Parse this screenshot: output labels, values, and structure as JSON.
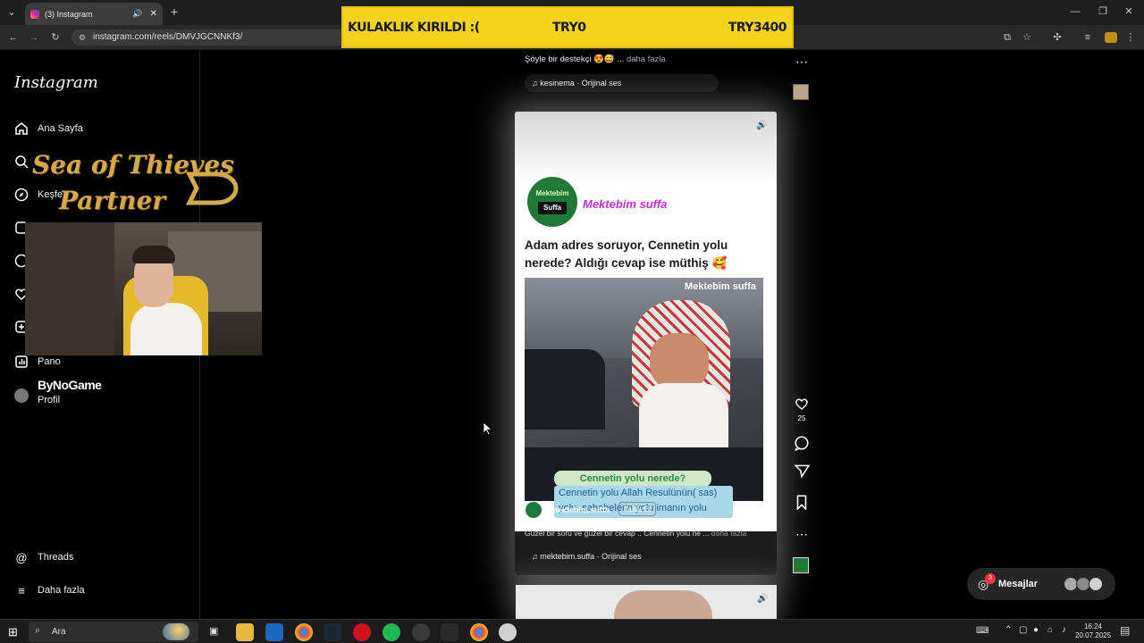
{
  "browser": {
    "tab_title": "(3) Instagram",
    "url": "instagram.com/reels/DMVJGCNNKf3/"
  },
  "banner": {
    "message": "KULAKLIK KIRILDI :(",
    "current": "TRY0",
    "goal": "TRY3400"
  },
  "sidebar": {
    "logo": "Instagram",
    "items": [
      {
        "label": "Ana Sayfa",
        "icon": "home-icon"
      },
      {
        "label": "Ara",
        "icon": "search-icon"
      },
      {
        "label": "Keşfet",
        "icon": "explore-icon"
      },
      {
        "label": "Reels",
        "icon": "reels-icon"
      },
      {
        "label": "Mesajlar",
        "icon": "messenger-icon"
      },
      {
        "label": "Bildirimler",
        "icon": "heart-icon"
      },
      {
        "label": "Oluştur",
        "icon": "plus-icon"
      },
      {
        "label": "Pano",
        "icon": "dashboard-icon"
      },
      {
        "label": "Profil",
        "icon": "avatar-icon"
      }
    ],
    "visible_labels": {
      "home": "Ana Sayfa",
      "explore_partial": "Keşfe",
      "dashboard": "Pano",
      "profile": "Profil",
      "threads": "Threads",
      "more": "Daha fazla"
    }
  },
  "overlay": {
    "sot_line1": "Sea of Thieves",
    "sot_line2": "Partner",
    "sponsor": "ByNoGame"
  },
  "reel_prev": {
    "caption": "Şöyle bir destekçi 😍😅 ...",
    "more": "daha fazla",
    "audio": "kesinema · Orijinal ses"
  },
  "reel": {
    "channel_badge_top": "Mektebim",
    "channel_badge_bottom": "Suffa",
    "channel_name": "Mektebim suffa",
    "question": "Adam adres soruyor, Cennetin yolu nerede? Aldığı cevap ise müthiş 🥰",
    "watermark": "Mektebim suffa",
    "subtitle_top": "Cennetin yolu nerede?",
    "subtitle_line1": "Cennetin yolu Allah Resulünün( sas)",
    "subtitle_line2": "yolu ,sahabelerin yolu   imanın yolu",
    "author": "mektebim.suffa",
    "follow": "Takip Et",
    "caption": "Güzel bir soru ve güzel bir cevap .. Cennetin yolu ne ...",
    "caption_more": "daha fazla",
    "audio": "mektebim.suffa · Orijinal ses",
    "likes": "25"
  },
  "messages": {
    "label": "Mesajlar",
    "badge": "3"
  },
  "taskbar": {
    "search": "Ara",
    "time": "16:24",
    "date": "20.07.2025"
  },
  "colors": {
    "banner_bg": "#f2d21b",
    "subtitle_bg": "#a7d8e8",
    "badge_red": "#ff3040",
    "channel_name": "#c02dd9"
  }
}
